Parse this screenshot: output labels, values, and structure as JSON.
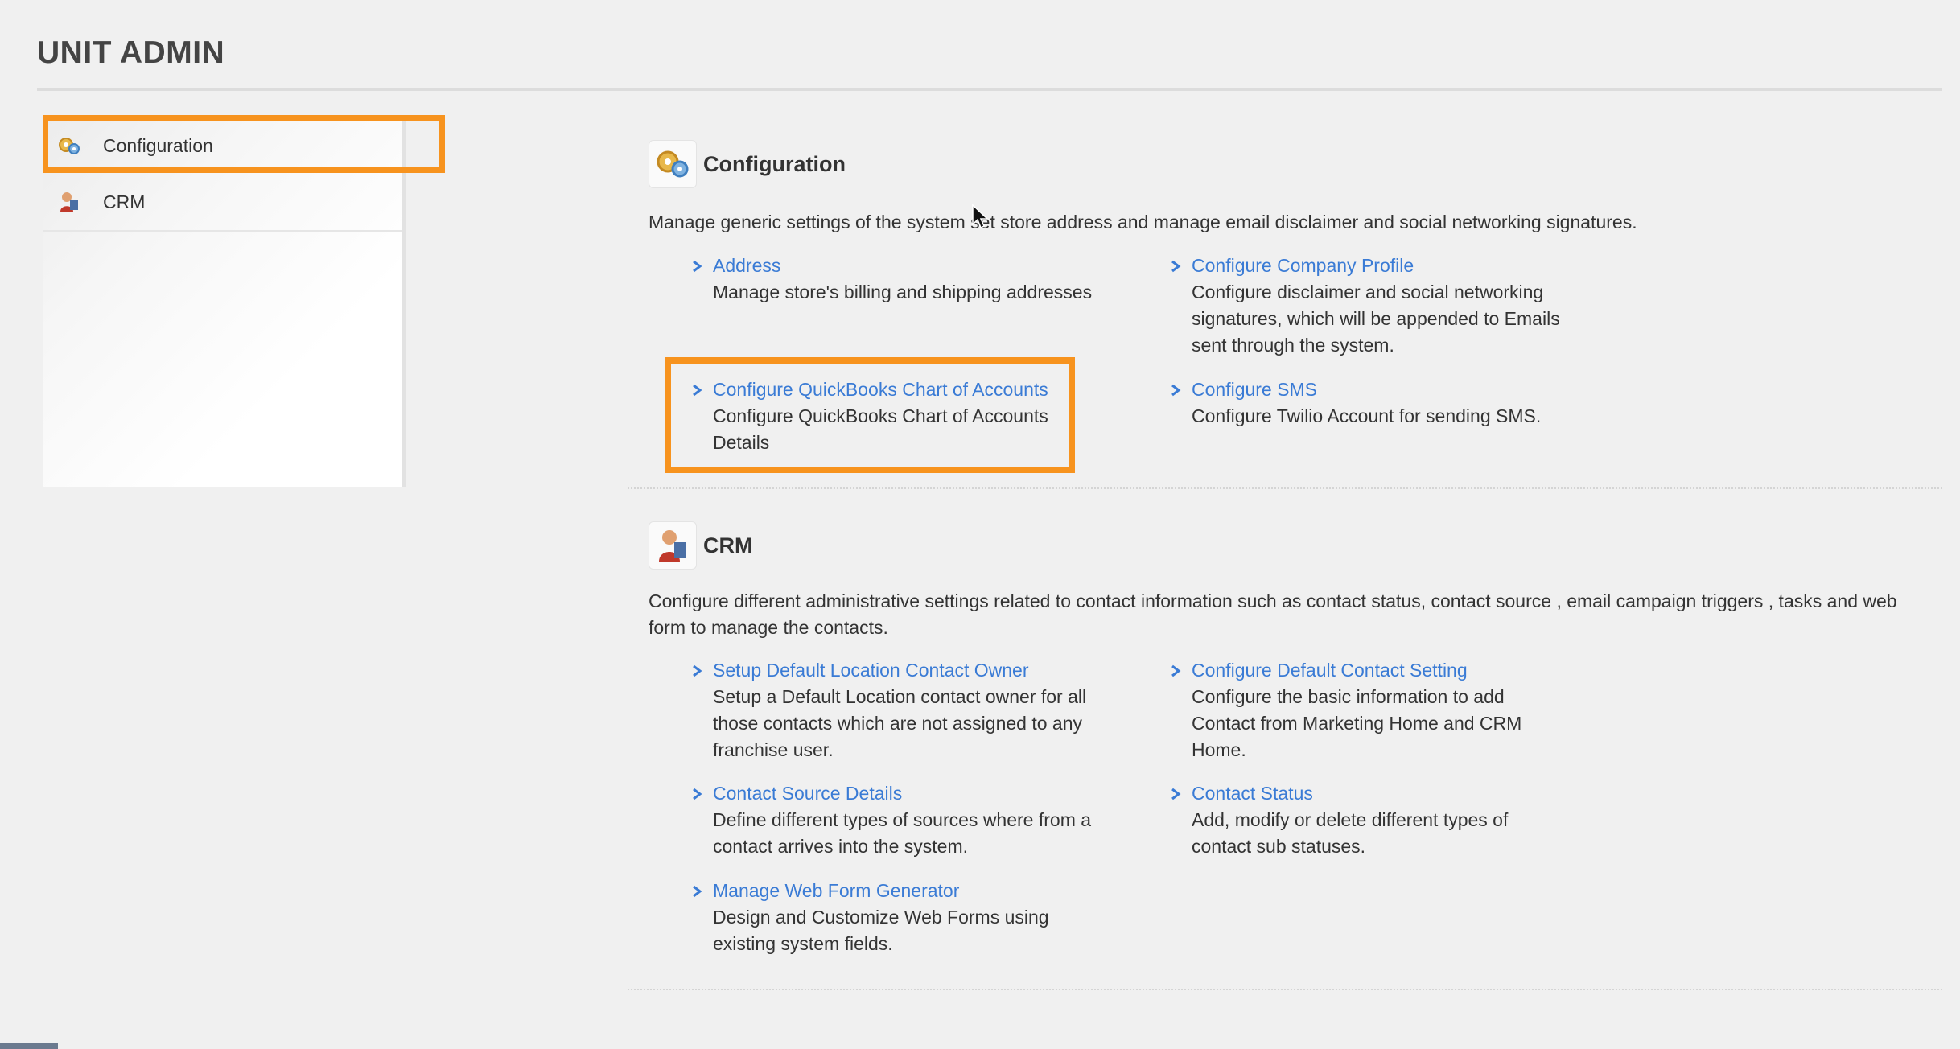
{
  "page": {
    "title": "UNIT ADMIN"
  },
  "sidebar": {
    "items": [
      {
        "label": "Configuration",
        "icon": "gears-icon",
        "highlighted": true
      },
      {
        "label": "CRM",
        "icon": "crm-user-icon",
        "highlighted": false
      }
    ]
  },
  "sections": [
    {
      "name": "Configuration",
      "icon": "gears-icon",
      "description": "Manage generic settings of the system set store address and manage email disclaimer and social networking signatures.",
      "entries": [
        {
          "link": "Address",
          "desc": "Manage store's billing and shipping addresses"
        },
        {
          "link": "Configure Company Profile",
          "desc": "Configure disclaimer and social networking signatures, which will be appended to Emails sent through the system."
        },
        {
          "link": "Configure QuickBooks Chart of Accounts",
          "desc": "Configure QuickBooks Chart of Accounts Details",
          "highlighted": true
        },
        {
          "link": "Configure SMS",
          "desc": "Configure Twilio Account for sending SMS."
        }
      ]
    },
    {
      "name": "CRM",
      "icon": "crm-user-icon",
      "description": "Configure different administrative settings related to contact information such as contact status, contact source , email campaign triggers , tasks and web form to manage the contacts.",
      "entries": [
        {
          "link": "Setup Default Location Contact Owner",
          "desc": "Setup a Default Location contact owner for all those contacts which are not assigned to any franchise user."
        },
        {
          "link": "Configure Default Contact Setting",
          "desc": "Configure the basic information to add Contact from Marketing Home and CRM Home."
        },
        {
          "link": "Contact Source Details",
          "desc": "Define different types of sources where from a contact arrives into the system."
        },
        {
          "link": "Contact Status",
          "desc": "Add, modify or delete different types of contact sub statuses."
        },
        {
          "link": "Manage Web Form Generator",
          "desc": "Design and Customize Web Forms using existing system fields."
        }
      ]
    }
  ],
  "colors": {
    "highlight": "#f7931e",
    "link": "#3a7bd5",
    "text": "#333333",
    "background": "#f0f0f0"
  }
}
